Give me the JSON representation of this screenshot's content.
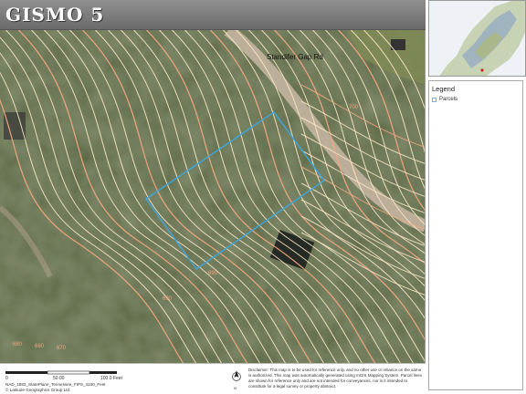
{
  "header": {
    "title": "GISMO 5"
  },
  "map": {
    "road_label": "Standifer Gap Rd",
    "contour_labels": [
      "680",
      "660",
      "670",
      "690",
      "690",
      "700"
    ],
    "colors": {
      "index_contour": "#f4a97f",
      "contour": "#fbe7c6",
      "parcel": "#3fa5d8",
      "road": "#c9b7a3",
      "forest_dark": "#2e3a22",
      "forest_mid": "#4d5a36"
    }
  },
  "inset": {
    "icon": "overview-map"
  },
  "legend": {
    "title": "Legend",
    "items": [
      {
        "label": "Parcels",
        "swatch_color": "#7ab0d6"
      }
    ]
  },
  "footer": {
    "scale_labels": [
      "0",
      "50.00",
      "100.0 Feet"
    ],
    "coordinates": "NAD_1983_StatePlane_Tennessee_FIPS_4100_Feet",
    "attribution": "© Latitude Geographics Group Ltd.",
    "north_label": "N",
    "disclaimer": "Disclaimer: This map is to be used for reference only, and no other use or reliance on the same is authorized. This map was automatically generated using mGIS Mapping System. Parcel lines are shown for reference only and are not intended for conveyances, nor is it intended to constitute for a legal survey or property abstract."
  }
}
